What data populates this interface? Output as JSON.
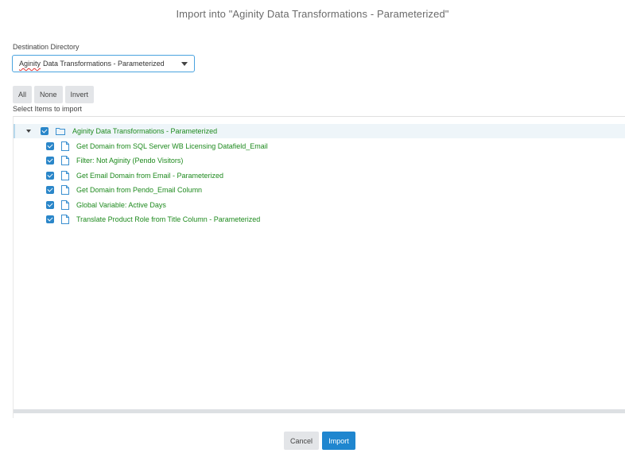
{
  "dialog": {
    "title": "Import into \"Aginity Data Transformations - Parameterized\""
  },
  "destination": {
    "label": "Destination Directory",
    "value_word1": "Aginity",
    "value_rest": "Data Transformations - Parameterized"
  },
  "selection_buttons": {
    "all": "All",
    "none": "None",
    "invert": "Invert"
  },
  "select_items_label": "Select Items to import",
  "tree": {
    "root": {
      "label": "Aginity Data Transformations - Parameterized",
      "checked": true,
      "expanded": true
    },
    "items": [
      {
        "label": "Get Domain from SQL Server WB Licensing Datafield_Email",
        "checked": true
      },
      {
        "label": "Filter: Not Aginity (Pendo Visitors)",
        "checked": true
      },
      {
        "label": "Get Email Domain from Email - Parameterized",
        "checked": true
      },
      {
        "label": "Get Domain from Pendo_Email Column",
        "checked": true
      },
      {
        "label": "Global Variable: Active Days",
        "checked": true
      },
      {
        "label": "Translate Product Role from Title Column - Parameterized",
        "checked": true
      }
    ]
  },
  "footer": {
    "cancel": "Cancel",
    "import": "Import"
  },
  "colors": {
    "accent": "#1f86cf",
    "item_text": "#1e8a1e",
    "checkbox": "#2a86c9"
  },
  "icons": {
    "root": "folder-icon",
    "item": "file-icon",
    "expand": "caret-down-icon",
    "dropdown": "chevron-down-icon"
  }
}
